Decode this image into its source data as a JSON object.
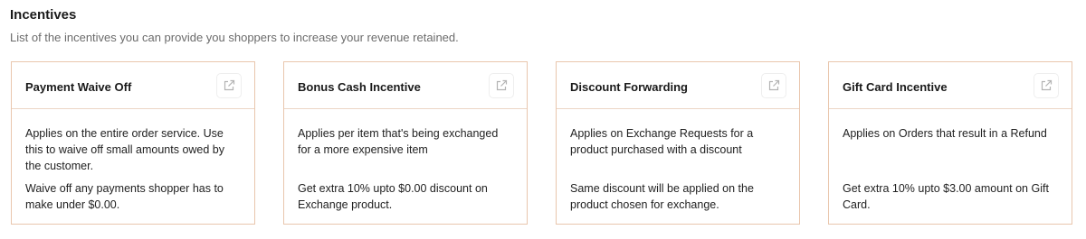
{
  "section": {
    "title": "Incentives",
    "subtitle": "List of the incentives you can provide you shoppers to increase your revenue retained."
  },
  "cards": [
    {
      "title": "Payment Waive Off",
      "description": "Applies on the entire order service. Use this to waive off small amounts owed by the customer.",
      "detail": "Waive off any payments shopper has to make under $0.00.",
      "icon": "external-link-icon"
    },
    {
      "title": "Bonus Cash Incentive",
      "description": "Applies per item that's being exchanged for a more expensive item",
      "detail": "Get extra 10% upto $0.00 discount on Exchange product.",
      "icon": "external-link-icon"
    },
    {
      "title": "Discount Forwarding",
      "description": "Applies on Exchange Requests for a product purchased with a discount",
      "detail": "Same discount will be applied on the product chosen for exchange.",
      "icon": "external-link-icon"
    },
    {
      "title": "Gift Card Incentive",
      "description": "Applies on Orders that result in a Refund",
      "detail": "Get extra 10% upto $3.00 amount on Gift Card.",
      "icon": "external-link-icon"
    }
  ],
  "colors": {
    "card_border": "#e9c6ad",
    "divider": "#ecd6c6",
    "icon": "#b3b3b3",
    "subtitle": "#6b6b6b"
  }
}
